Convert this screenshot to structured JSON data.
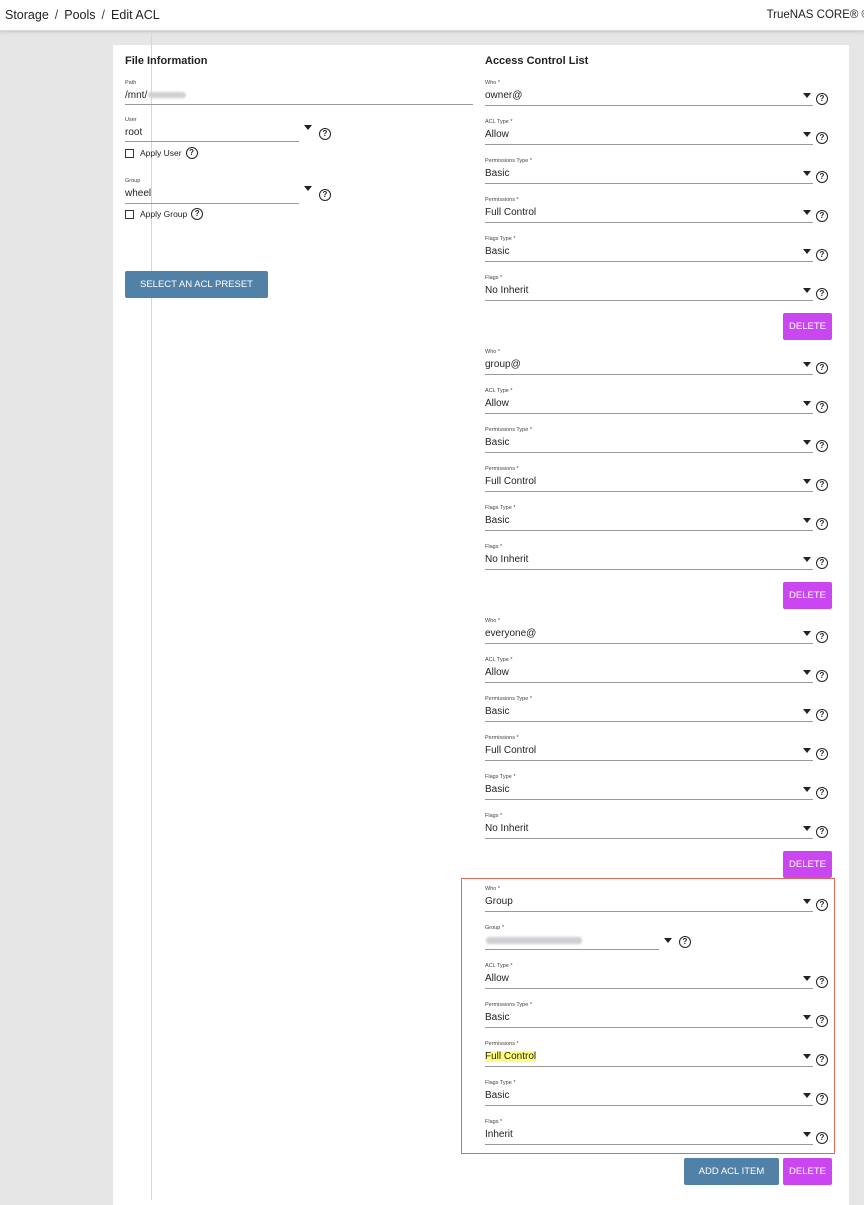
{
  "breadcrumb": [
    "Storage",
    "Pools",
    "Edit ACL"
  ],
  "brand": "TrueNAS CORE® © 20",
  "file_info": {
    "title": "File Information",
    "path_label": "Path",
    "path_value": "/mnt/",
    "user_label": "User",
    "user_value": "root",
    "apply_user": "Apply User",
    "group_label": "Group",
    "group_value": "wheel",
    "apply_group": "Apply Group",
    "preset_button": "SELECT AN ACL PRESET"
  },
  "acl": {
    "title": "Access Control List",
    "entries": [
      {
        "fields": [
          {
            "label": "Who *",
            "value": "owner@"
          },
          {
            "label": "ACL Type *",
            "value": "Allow"
          },
          {
            "label": "Permissions Type *",
            "value": "Basic"
          },
          {
            "label": "Permissions *",
            "value": "Full Control"
          },
          {
            "label": "Flags Type *",
            "value": "Basic"
          },
          {
            "label": "Flags *",
            "value": "No Inherit"
          }
        ],
        "delete": "DELETE"
      },
      {
        "fields": [
          {
            "label": "Who *",
            "value": "group@"
          },
          {
            "label": "ACL Type *",
            "value": "Allow"
          },
          {
            "label": "Permissions Type *",
            "value": "Basic"
          },
          {
            "label": "Permissions *",
            "value": "Full Control"
          },
          {
            "label": "Flags Type *",
            "value": "Basic"
          },
          {
            "label": "Flags *",
            "value": "No Inherit"
          }
        ],
        "delete": "DELETE"
      },
      {
        "fields": [
          {
            "label": "Who *",
            "value": "everyone@"
          },
          {
            "label": "ACL Type *",
            "value": "Allow"
          },
          {
            "label": "Permissions Type *",
            "value": "Basic"
          },
          {
            "label": "Permissions *",
            "value": "Full Control"
          },
          {
            "label": "Flags Type *",
            "value": "Basic"
          },
          {
            "label": "Flags *",
            "value": "No Inherit"
          }
        ],
        "delete": "DELETE"
      },
      {
        "fields": [
          {
            "label": "Who *",
            "value": "Group"
          },
          {
            "label": "Group *",
            "value": ""
          },
          {
            "label": "ACL Type *",
            "value": "Allow"
          },
          {
            "label": "Permissions Type *",
            "value": "Basic"
          },
          {
            "label": "Permissions *",
            "value": "Full Control"
          },
          {
            "label": "Flags Type *",
            "value": "Basic"
          },
          {
            "label": "Flags *",
            "value": "Inherit"
          }
        ],
        "delete": "DELETE"
      }
    ],
    "add_button": "ADD ACL ITEM"
  },
  "help_glyph": "?",
  "colors": {
    "primary_button": "#5181a7",
    "delete_button": "#c946f0",
    "highlight_border": "#e06a5a",
    "text_highlight": "#ffff7a"
  }
}
